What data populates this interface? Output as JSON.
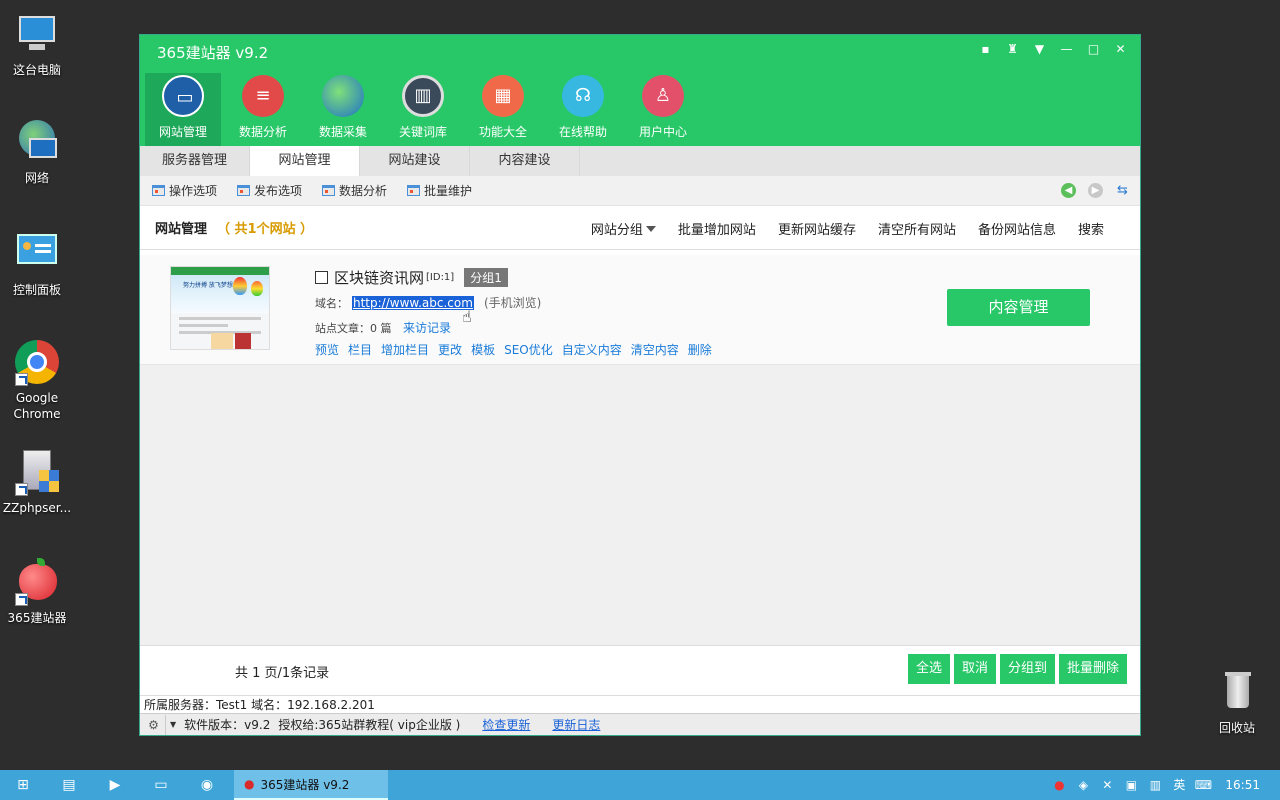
{
  "desktop": {
    "icons": [
      {
        "label": "这台电脑",
        "icon": "this-pc-icon"
      },
      {
        "label": "网络",
        "icon": "network-icon"
      },
      {
        "label": "控制面板",
        "icon": "control-panel-icon"
      },
      {
        "label": "Google Chrome",
        "icon": "chrome-icon"
      },
      {
        "label": "ZZphpser...",
        "icon": "zzphpserver-icon"
      },
      {
        "label": "365建站器",
        "icon": "apple-app-icon"
      },
      {
        "label": "回收站",
        "icon": "recycle-bin-icon"
      }
    ]
  },
  "window": {
    "title": "365建站器 v9.2",
    "controls": {
      "feedback": "feedback-icon",
      "skin": "shirt-icon",
      "menu": "menu-icon",
      "minimize": "minimize-icon",
      "maximize": "maximize-icon",
      "close": "close-icon"
    }
  },
  "nav": [
    {
      "label": "网站管理",
      "icon": "monitor-icon",
      "color": "#1f5fa8"
    },
    {
      "label": "数据分析",
      "icon": "database-icon",
      "color": "#e24a4a"
    },
    {
      "label": "数据采集",
      "icon": "globe-icon",
      "color": "#2a86d0"
    },
    {
      "label": "关键词库",
      "icon": "book-icon",
      "color": "#3a4a5a"
    },
    {
      "label": "功能大全",
      "icon": "grid-icon",
      "color": "#f06a4a"
    },
    {
      "label": "在线帮助",
      "icon": "headset-icon",
      "color": "#36b8e0"
    },
    {
      "label": "用户中心",
      "icon": "user-icon",
      "color": "#e2506a"
    }
  ],
  "tabs": [
    "服务器管理",
    "网站管理",
    "网站建设",
    "内容建设"
  ],
  "subbar": [
    "操作选项",
    "发布选项",
    "数据分析",
    "批量维护"
  ],
  "manager": {
    "title": "网站管理",
    "count": "（ 共1个网站 ）",
    "actions": [
      "网站分组",
      "批量增加网站",
      "更新网站缓存",
      "清空所有网站",
      "备份网站信息",
      "搜索"
    ]
  },
  "site": {
    "name": "区块链资讯网",
    "id": "[ID:1]",
    "group": "分组1",
    "domain_label": "域名：",
    "url": "http://www.abc.com",
    "mobile": "(手机浏览)",
    "articles": "站点文章：0 篇",
    "visits_link": "来访记录",
    "ops": [
      "预览",
      "栏目",
      "增加栏目",
      "更改",
      "模板",
      "SEO优化",
      "自定义内容",
      "清空内容",
      "删除"
    ],
    "content_button": "内容管理",
    "thumb_text": "努力拼搏 放飞梦想"
  },
  "pager": {
    "text": "共 1 页/1条记录",
    "buttons": [
      "全选",
      "取消",
      "分组到",
      "批量删除"
    ]
  },
  "server": "所属服务器：Test1 域名：192.168.2.201",
  "status": {
    "version": "软件版本：v9.2",
    "license": "授权给:365站群教程( vip企业版 )",
    "check_update": "检查更新",
    "update_log": "更新日志"
  },
  "taskbar": {
    "app_label": "365建站器 v9.2",
    "ime": "英",
    "time": "16:51"
  }
}
